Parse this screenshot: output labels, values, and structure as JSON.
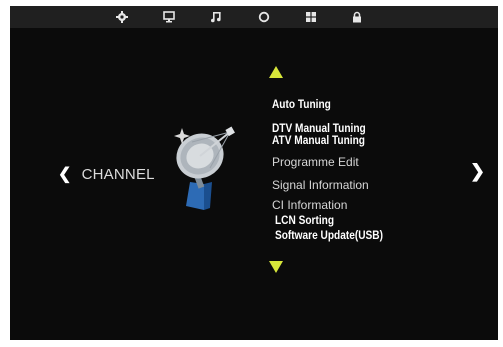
{
  "top_tabs": [
    {
      "icon": "gear-icon"
    },
    {
      "icon": "monitor-icon"
    },
    {
      "icon": "music-note-icon"
    },
    {
      "icon": "clock-icon"
    },
    {
      "icon": "grid-icon"
    },
    {
      "icon": "lock-icon"
    }
  ],
  "page": {
    "title": "CHANNEL",
    "prev": "❮",
    "next": "❯"
  },
  "menu": {
    "items": [
      {
        "label": "Auto Tuning"
      },
      {
        "label": "DTV Manual Tuning"
      },
      {
        "label": "ATV Manual Tuning"
      },
      {
        "label": "Programme Edit"
      },
      {
        "label": "Signal Information"
      },
      {
        "label": "CI Information"
      },
      {
        "label": "LCN Sorting"
      },
      {
        "label": "Software Update(USB)"
      }
    ]
  },
  "colors": {
    "accent_arrow": "#d7e63a",
    "background": "#0b0b0b",
    "topbar": "#202020"
  }
}
